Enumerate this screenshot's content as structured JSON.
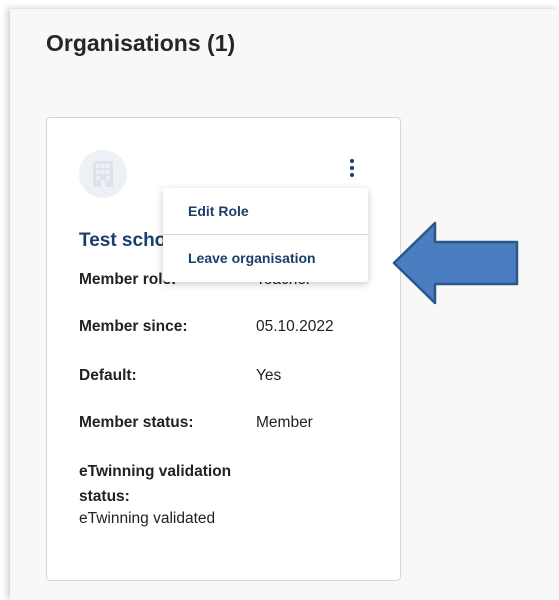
{
  "page": {
    "title": "Organisations (1)"
  },
  "organisation_card": {
    "name": "Test school",
    "logo_icon": "building-icon",
    "menu_icon": "kebab-menu-icon",
    "details": {
      "member_role_label": "Member role:",
      "member_role_value": "Teacher",
      "member_since_label": "Member since:",
      "member_since_value": "05.10.2022",
      "default_label": "Default:",
      "default_value": "Yes",
      "member_status_label": "Member status:",
      "member_status_value": "Member",
      "validation_label": "eTwinning validation status:",
      "validation_value": "eTwinning validated"
    }
  },
  "dropdown_menu": {
    "items": [
      {
        "label": "Edit Role"
      },
      {
        "label": "Leave organisation"
      }
    ]
  },
  "annotation": {
    "arrow_icon": "left-arrow-icon",
    "arrow_color": "#4a7ec0"
  },
  "colors": {
    "brand_navy": "#1b3e6b",
    "text": "#222222",
    "panel_bg": "#f8f8f8"
  }
}
